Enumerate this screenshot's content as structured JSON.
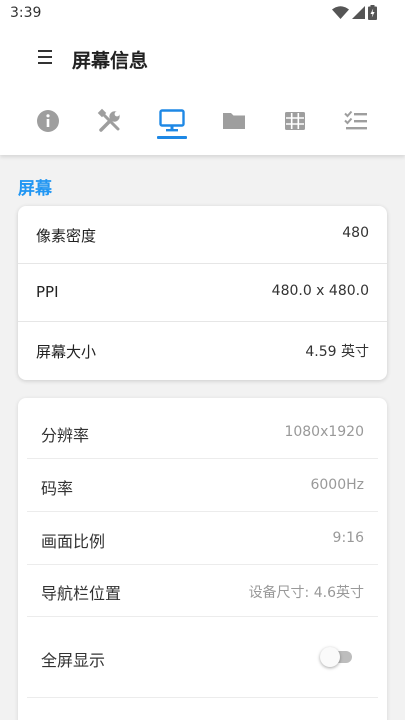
{
  "status_bar": {
    "time": "3:39",
    "icons": [
      "wifi-icon",
      "cell-signal-icon",
      "battery-charging-icon"
    ]
  },
  "header": {
    "title": "屏幕信息",
    "menu_icon": "hamburger-menu-icon"
  },
  "tabs": [
    {
      "icon": "info-icon",
      "selected": false
    },
    {
      "icon": "tools-icon",
      "selected": false
    },
    {
      "icon": "monitor-icon",
      "selected": true
    },
    {
      "icon": "folder-icon",
      "selected": false
    },
    {
      "icon": "grid-icon",
      "selected": false
    },
    {
      "icon": "checklist-icon",
      "selected": false
    }
  ],
  "colors": {
    "accent": "#1e88e5",
    "section_title": "#2196f3",
    "icon_inactive": "#9e9e9e",
    "background": "#f2f2f2"
  },
  "section": {
    "title": "屏幕"
  },
  "card1": {
    "rows": [
      {
        "label": "像素密度",
        "value": "480"
      },
      {
        "label": "PPI",
        "value": "480.0 x 480.0"
      },
      {
        "label": "屏幕大小",
        "value": "4.59 英寸"
      }
    ]
  },
  "card2": {
    "rows": [
      {
        "label": "分辨率",
        "value": "1080x1920"
      },
      {
        "label": "码率",
        "value": "6000Hz"
      },
      {
        "label": "画面比例",
        "value": "9:16"
      },
      {
        "label": "导航栏位置",
        "value": "设备尺寸: 4.6英寸"
      }
    ],
    "fullscreen": {
      "label": "全屏显示",
      "enabled": false
    }
  }
}
